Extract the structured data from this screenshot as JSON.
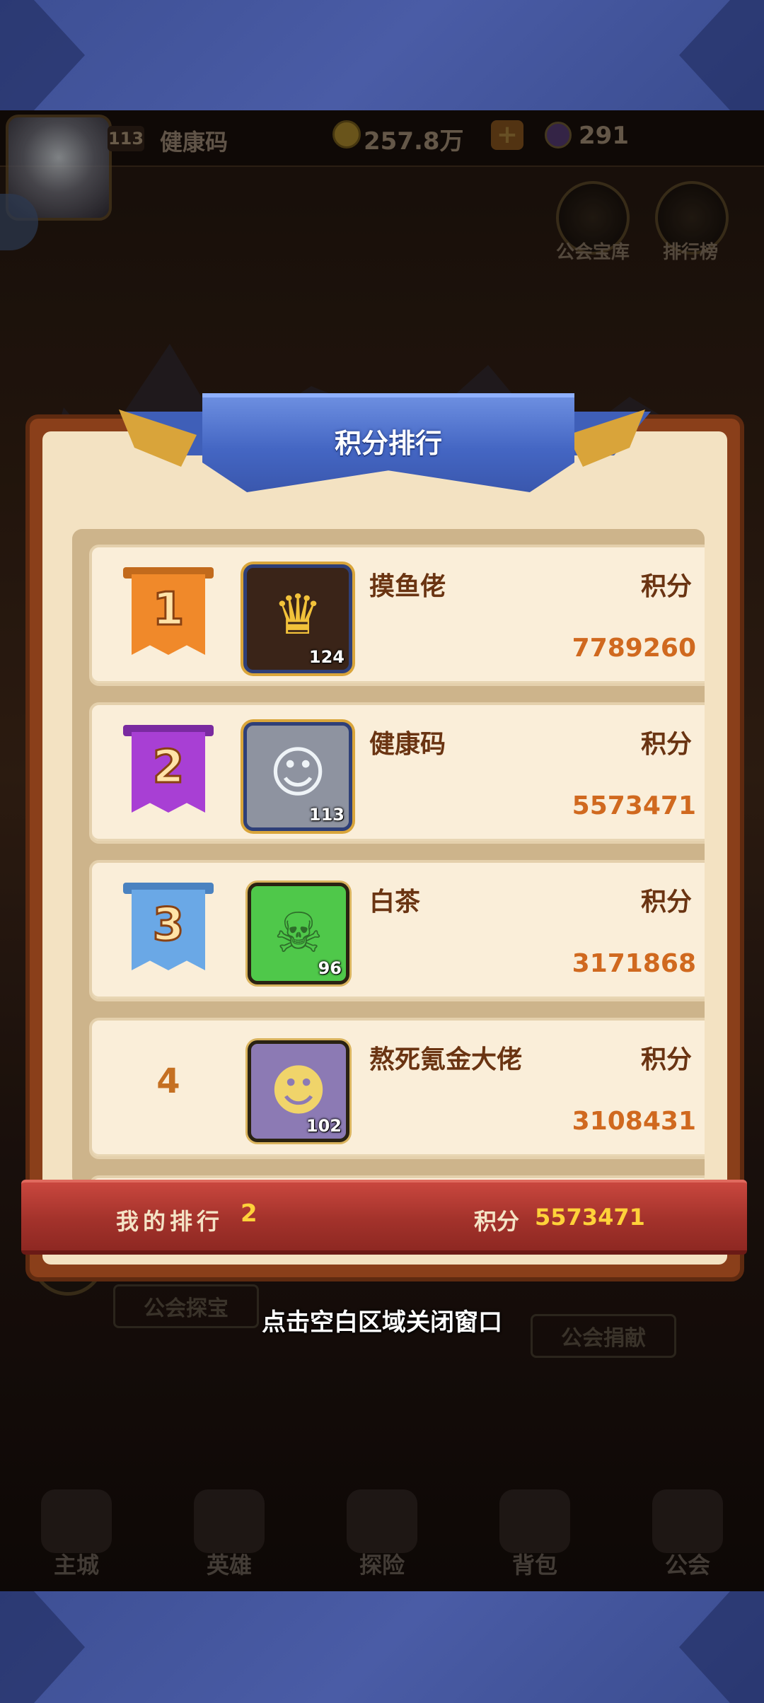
{
  "hud": {
    "player_level": "113",
    "player_name": "健康码",
    "gold": "257.8万",
    "plus": "+",
    "gems": "291",
    "buttons": [
      {
        "label": "公会宝库",
        "icon": "treasury-icon"
      },
      {
        "label": "排行榜",
        "icon": "leaderboard-icon"
      }
    ],
    "guild_treasure_hunt": "公会探宝",
    "guild_donate": "公会捐献"
  },
  "nav": [
    {
      "label": "主城",
      "icon": "castle-icon"
    },
    {
      "label": "英雄",
      "icon": "hero-icon"
    },
    {
      "label": "探险",
      "icon": "portal-icon"
    },
    {
      "label": "背包",
      "icon": "backpack-icon"
    },
    {
      "label": "公会",
      "icon": "guild-icon"
    }
  ],
  "dialog": {
    "title": "积分排行",
    "rows": [
      {
        "rank": "1",
        "name": "摸鱼佬",
        "score_label": "积分",
        "score": "7789260",
        "level": "124",
        "flag_color": "#f0892a",
        "flag_bar": "#c26a1c",
        "avatar_bg": "#3a2418",
        "avatar_glyph": "♛",
        "glyph_color": "#f2c23a"
      },
      {
        "rank": "2",
        "name": "健康码",
        "score_label": "积分",
        "score": "5573471",
        "level": "113",
        "flag_color": "#a83fd4",
        "flag_bar": "#7a2aa0",
        "avatar_bg": "#8e93a0",
        "avatar_glyph": "☺",
        "glyph_color": "#eef3f7"
      },
      {
        "rank": "3",
        "name": "白茶",
        "score_label": "积分",
        "score": "3171868",
        "level": "96",
        "flag_color": "#6aa8e6",
        "flag_bar": "#4a82c0",
        "avatar_bg": "#4fc84a",
        "avatar_glyph": "☠",
        "glyph_color": "#2e6e2a"
      },
      {
        "rank": "4",
        "name": "熬死氪金大佬",
        "score_label": "积分",
        "score": "3108431",
        "level": "102",
        "avatar_bg": "#8c7ab4",
        "avatar_glyph": "☻",
        "glyph_color": "#f0d46a"
      }
    ],
    "my_rank_label": "我的排行",
    "my_rank": "2",
    "my_score_label": "积分",
    "my_score": "5573471"
  },
  "close_hint": "点击空白区域关闭窗口"
}
